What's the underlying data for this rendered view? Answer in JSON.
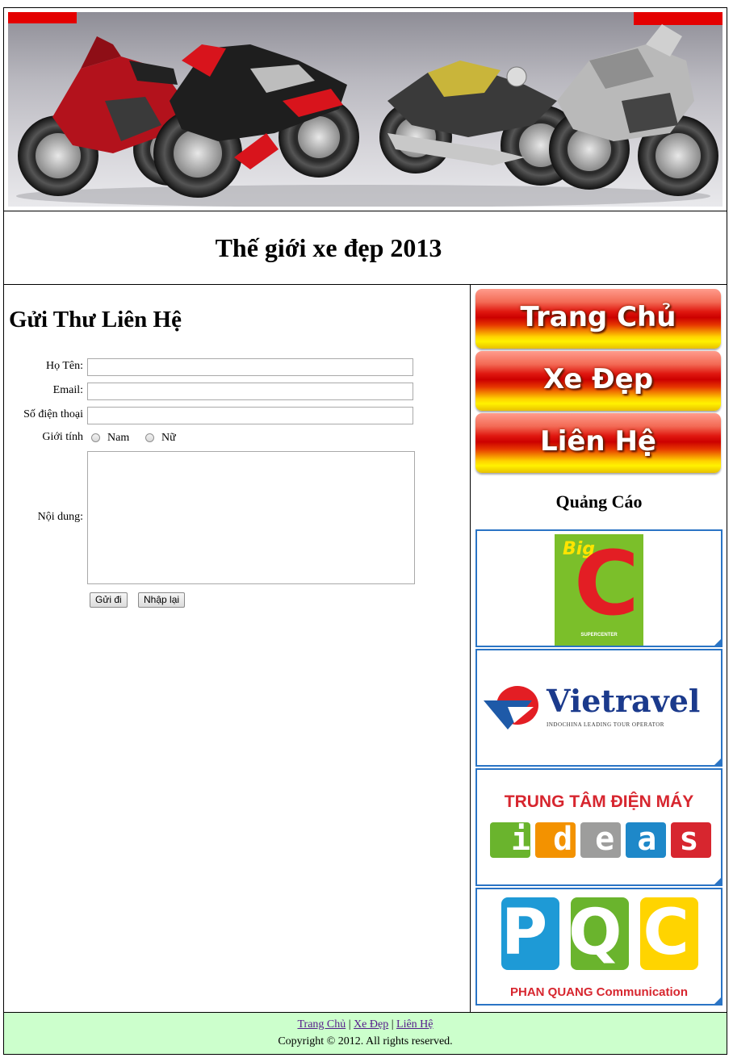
{
  "header": {
    "title": "Thế giới xe đẹp 2013"
  },
  "contact_form": {
    "heading": "Gửi Thư Liên Hệ",
    "name_label": "Họ Tên:",
    "name_value": "",
    "email_label": "Email:",
    "email_value": "",
    "phone_label": "Số điện thoại",
    "phone_value": "",
    "gender_label": "Giới tính",
    "gender_options": [
      "Nam",
      "Nữ"
    ],
    "content_label": "Nội dung:",
    "content_value": "",
    "submit_label": "Gửi đi",
    "reset_label": "Nhập lại"
  },
  "sidebar": {
    "nav": [
      {
        "label": "Trang Chủ"
      },
      {
        "label": "Xe Đẹp"
      },
      {
        "label": "Liên Hệ"
      }
    ],
    "ads_heading": "Quảng Cáo",
    "ads": [
      {
        "name": "Big C",
        "text_main": "Big",
        "text_letter": "C",
        "text_sub": "SUPERCENTER",
        "color": "#e31e24"
      },
      {
        "name": "Vietravel",
        "text_main": "Vietravel",
        "text_sub": "INDOCHINA LEADING TOUR OPERATOR",
        "color": "#1b3a8c"
      },
      {
        "name": "Ideas",
        "text_main": "TRUNG TÂM ĐIỆN MÁY",
        "text_sub": "ideas",
        "color": "#d7262f"
      },
      {
        "name": "PQC",
        "text_main": "PQC",
        "text_sub": "PHAN QUANG Communication",
        "color": "#d7262f"
      }
    ]
  },
  "footer": {
    "links": [
      "Trang Chủ",
      "Xe Đẹp",
      "Liên Hệ"
    ],
    "separator": "|",
    "copyright": "Copyright © 2012. All rights reserved."
  },
  "colors": {
    "footer_bg": "#ccffcc",
    "ad_border": "#2a74c5",
    "link": "#551a8b"
  }
}
